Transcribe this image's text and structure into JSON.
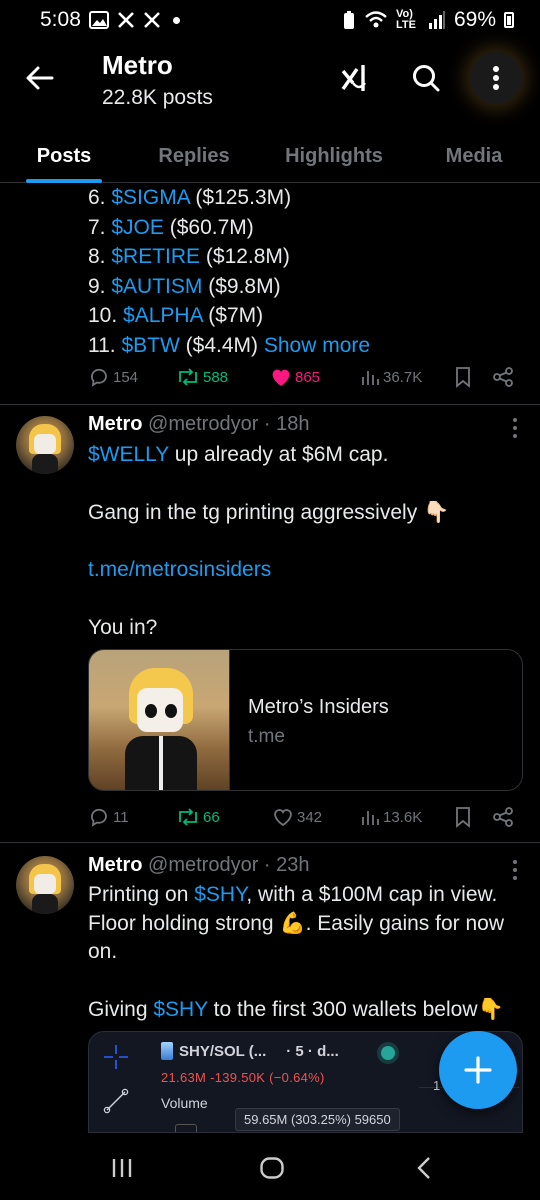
{
  "status_bar": {
    "time": "5:08",
    "network": "Vo) LTE",
    "battery": "69%"
  },
  "header": {
    "title": "Metro",
    "subtitle": "22.8K posts"
  },
  "tabs": [
    {
      "label": "Posts",
      "active": true
    },
    {
      "label": "Replies",
      "active": false
    },
    {
      "label": "Highlights",
      "active": false
    },
    {
      "label": "Media",
      "active": false
    }
  ],
  "post0": {
    "lines": [
      {
        "num": "6.",
        "tag": "$SIGMA",
        "val": "($125.3M)"
      },
      {
        "num": "7.",
        "tag": "$JOE",
        "val": "($60.7M)"
      },
      {
        "num": "8.",
        "tag": "$RETIRE",
        "val": "($12.8M)"
      },
      {
        "num": "9.",
        "tag": "$AUTISM",
        "val": "($9.8M)"
      },
      {
        "num": "10.",
        "tag": "$ALPHA",
        "val": "($7M)"
      },
      {
        "num": "11.",
        "tag": "$BTW",
        "val": "($4.4M)"
      }
    ],
    "show_more": "Show more",
    "replies": "154",
    "reposts": "588",
    "likes": "865",
    "views": "36.7K"
  },
  "post1": {
    "name": "Metro",
    "handle": "@metrodyor",
    "time": "· 18h",
    "tag": "$WELLY",
    "line1_rest": " up already at $6M cap.",
    "line2": "Gang in the tg printing aggressively 👇🏻",
    "link": "t.me/metrosinsiders",
    "line3": "You in?",
    "card_title": "Metro’s Insiders",
    "card_domain": "t.me",
    "replies": "11",
    "reposts": "66",
    "likes": "342",
    "views": "13.6K"
  },
  "post2": {
    "name": "Metro",
    "handle": "@metrodyor",
    "time": "· 23h",
    "p1_a": "Printing on ",
    "tag": "$SHY",
    "p1_b": ", with a $100M cap in view. Floor holding strong 💪. Easily gains for now on.",
    "p2_a": "Giving ",
    "p2_b": " to the first 300 wallets below👇",
    "chart": {
      "symbol": "SHY/SOL (...",
      "interval": "· 5 · d...",
      "values": "21.63M  -139.50K (−0.64%)",
      "volume": "Volume",
      "tooltip": "59.65M (303.25%) 59650",
      "edge": "1"
    }
  }
}
